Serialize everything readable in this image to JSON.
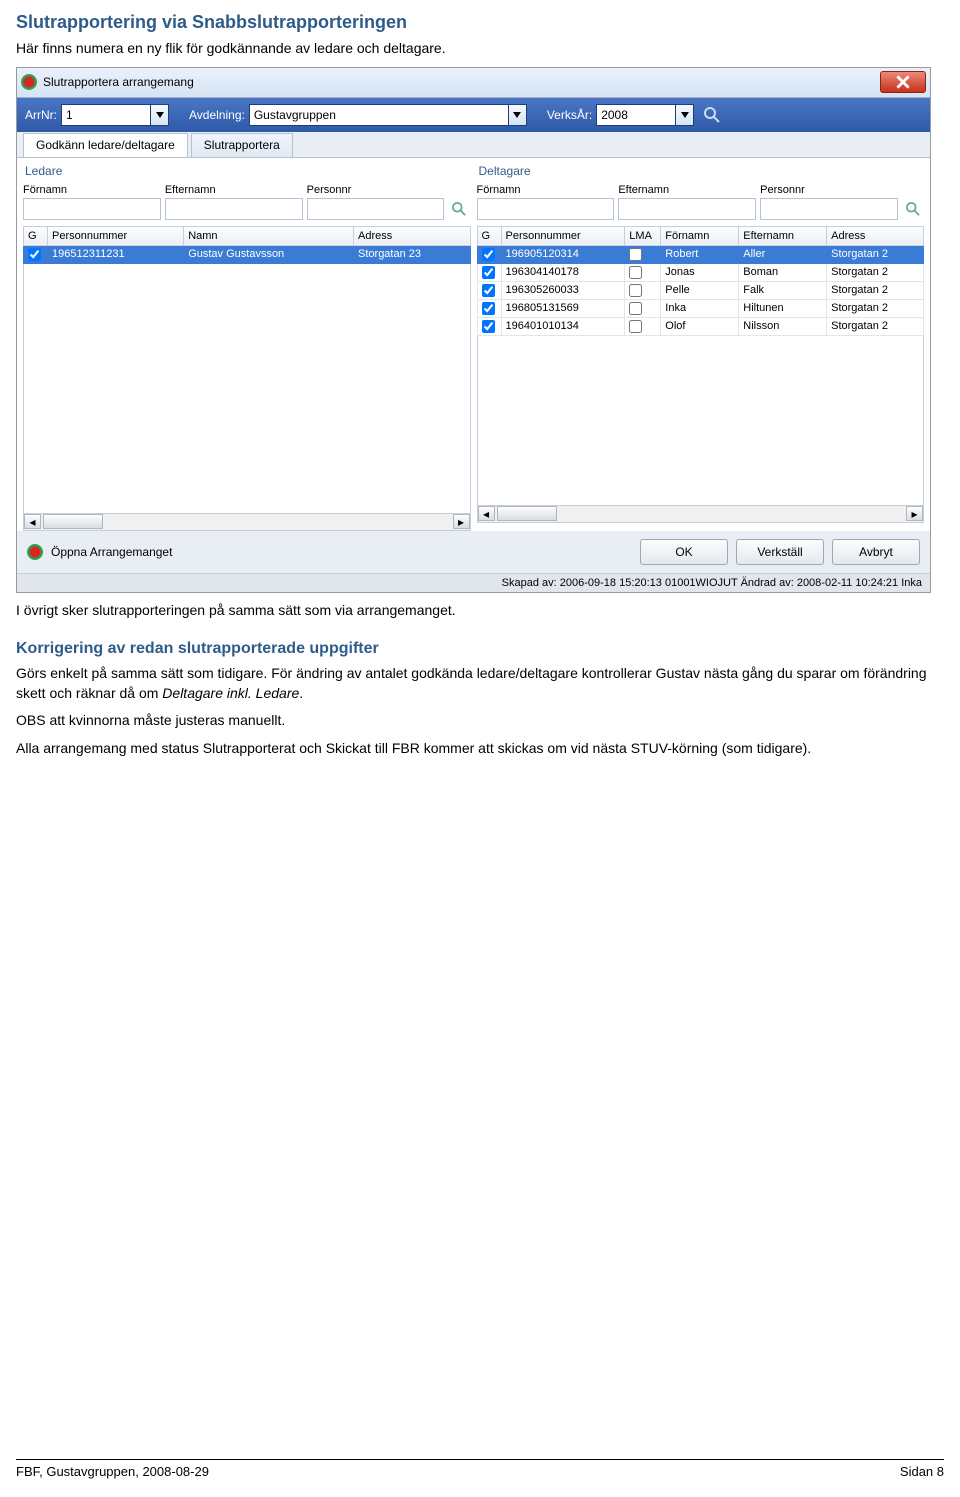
{
  "doc": {
    "heading1": "Slutrapportering via Snabbslutrapporteringen",
    "intro": "Här finns numera en ny flik för godkännande av ledare och deltagare.",
    "after_img": "I övrigt sker slutrapporteringen på samma sätt som via arrangemanget.",
    "heading2": "Korrigering av redan slutrapporterade uppgifter",
    "p1a": "Görs enkelt på samma sätt som tidigare. För ändring av antalet godkända ledare/deltagare kontrollerar Gustav nästa gång du sparar om förändring skett och räknar då om ",
    "p1_italic": "Deltagare inkl. Ledare",
    "p1b": ".",
    "p2": "OBS att kvinnorna måste justeras manuellt.",
    "p3": "Alla arrangemang med status Slutrapporterat och Skickat till FBR kommer att skickas om vid nästa STUV-körning (som tidigare).",
    "footer_left": "FBF, Gustavgruppen, 2008-08-29",
    "footer_right": "Sidan 8"
  },
  "win": {
    "title": "Slutrapportera arrangemang",
    "toolbar": {
      "arrnr_label": "ArrNr:",
      "arrnr_value": "1",
      "avd_label": "Avdelning:",
      "avd_value": "Gustavgruppen",
      "verksar_label": "VerksÅr:",
      "verksar_value": "2008"
    },
    "tabs": {
      "t1": "Godkänn ledare/deltagare",
      "t2": "Slutrapportera"
    },
    "ledare": {
      "pane_title": "Ledare",
      "search": {
        "c1": "Förnamn",
        "c2": "Efternamn",
        "c3": "Personnr"
      },
      "cols": {
        "G": "G",
        "Personnummer": "Personnummer",
        "Namn": "Namn",
        "Adress": "Adress"
      },
      "rows": [
        {
          "G": true,
          "Personnummer": "196512311231",
          "Namn": "Gustav Gustavsson",
          "Adress": "Storgatan 23"
        }
      ]
    },
    "deltagare": {
      "pane_title": "Deltagare",
      "search": {
        "c1": "Förnamn",
        "c2": "Efternamn",
        "c3": "Personnr"
      },
      "cols": {
        "G": "G",
        "Personnummer": "Personnummer",
        "LMA": "LMA",
        "Fornamn": "Förnamn",
        "Efternamn": "Efternamn",
        "Adress": "Adress"
      },
      "rows": [
        {
          "G": true,
          "Personnummer": "196905120314",
          "LMA": false,
          "Fornamn": "Robert",
          "Efternamn": "Aller",
          "Adress": "Storgatan 2"
        },
        {
          "G": true,
          "Personnummer": "196304140178",
          "LMA": false,
          "Fornamn": "Jonas",
          "Efternamn": "Boman",
          "Adress": "Storgatan 2"
        },
        {
          "G": true,
          "Personnummer": "196305260033",
          "LMA": false,
          "Fornamn": "Pelle",
          "Efternamn": "Falk",
          "Adress": "Storgatan 2"
        },
        {
          "G": true,
          "Personnummer": "196805131569",
          "LMA": false,
          "Fornamn": "Inka",
          "Efternamn": "Hiltunen",
          "Adress": "Storgatan 2"
        },
        {
          "G": true,
          "Personnummer": "196401010134",
          "LMA": false,
          "Fornamn": "Olof",
          "Efternamn": "Nilsson",
          "Adress": "Storgatan 2"
        }
      ]
    },
    "bottom": {
      "open_link": "Öppna Arrangemanget",
      "ok": "OK",
      "verkstall": "Verkställ",
      "avbryt": "Avbryt"
    },
    "status": "Skapad av: 2006-09-18 15:20:13 01001WIOJUT Ändrad av: 2008-02-11 10:24:21 Inka"
  }
}
